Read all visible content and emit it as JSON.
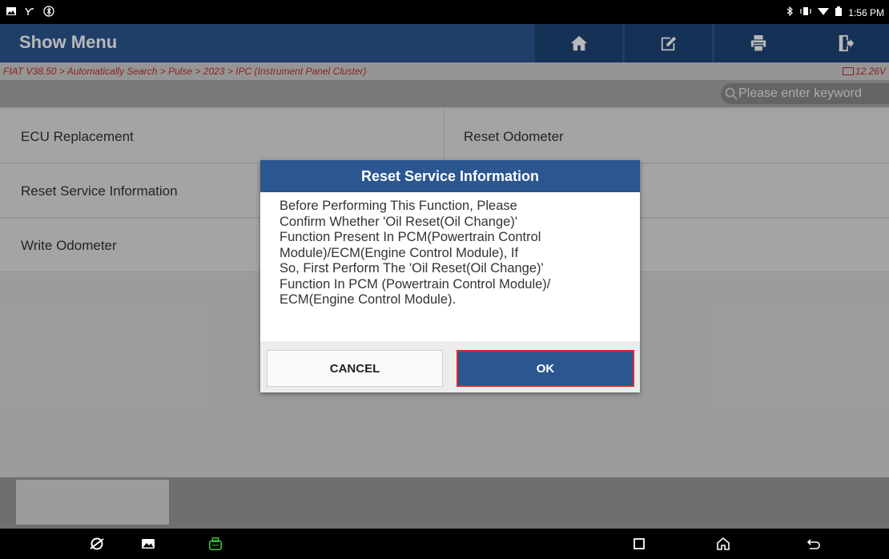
{
  "status_bar": {
    "time": "1:56 PM"
  },
  "header": {
    "title": "Show Menu",
    "buttons": [
      "home-icon",
      "edit-icon",
      "print-icon",
      "exit-icon"
    ]
  },
  "breadcrumb": {
    "path": "FIAT V38.50 > Automatically Search > Pulse > 2023 > IPC (Instrument Panel Cluster)",
    "voltage": "12.26V"
  },
  "search": {
    "placeholder": "Please enter keyword"
  },
  "menu": {
    "rows": [
      {
        "left": "ECU Replacement",
        "right": "Reset Odometer"
      },
      {
        "left": "Reset Service Information",
        "right": ""
      },
      {
        "left": "Write Odometer",
        "right": ""
      }
    ]
  },
  "dialog": {
    "title": "Reset Service Information",
    "message_lines": [
      "Before Performing This Function, Please",
      "Confirm Whether 'Oil Reset(Oil Change)'",
      "Function Present In PCM(Powertrain Control",
      "Module)/ECM(Engine Control Module), If",
      "So, First Perform The 'Oil Reset(Oil Change)'",
      "Function In PCM (Powertrain Control Module)/",
      "ECM(Engine Control Module)."
    ],
    "cancel_label": "CANCEL",
    "ok_label": "OK"
  },
  "colors": {
    "header_bg": "#2b5690",
    "header_btn_bg": "#1f4578",
    "breadcrumb_text": "#c0322d",
    "ok_border": "#d82a2a",
    "vci_icon": "#3fbf3f"
  }
}
